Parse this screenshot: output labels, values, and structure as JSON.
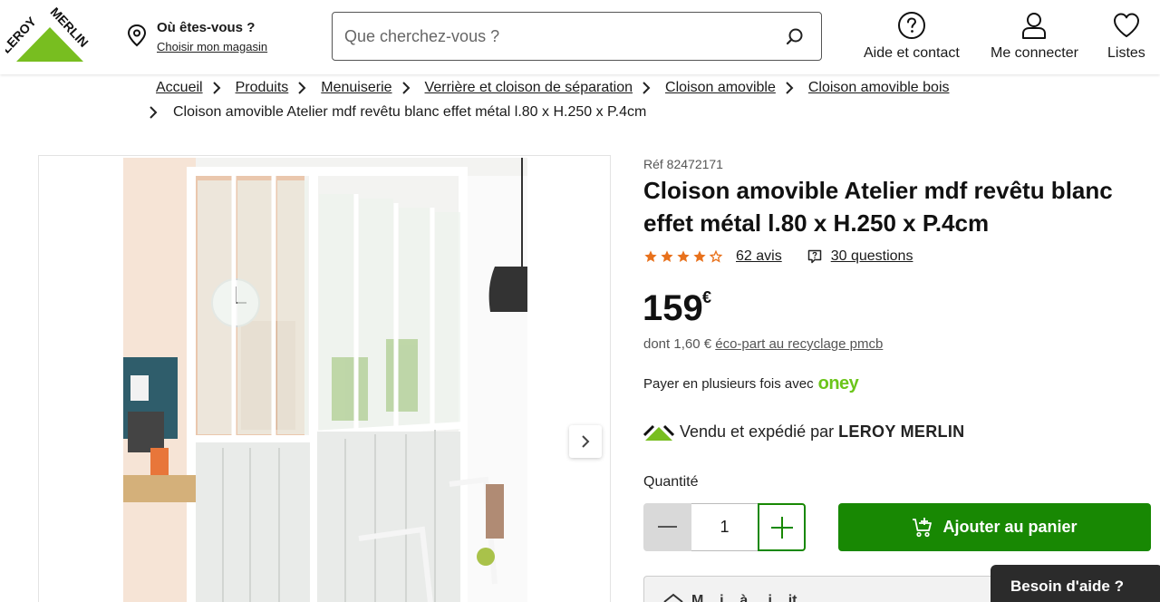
{
  "brand": {
    "logo_text": "LEROY MERLIN",
    "primary_color": "#78be20",
    "accent_green": "#188803"
  },
  "header": {
    "store_title": "Où êtes-vous ?",
    "store_link": "Choisir mon magasin",
    "search_placeholder": "Que cherchez-vous ?",
    "help": "Aide et contact",
    "login": "Me connecter",
    "lists": "Listes"
  },
  "breadcrumb": {
    "items": [
      "Accueil",
      "Produits",
      "Menuiserie",
      "Verrière et cloison de séparation",
      "Cloison amovible",
      "Cloison amovible bois"
    ],
    "current": "Cloison amovible Atelier mdf revêtu blanc effet métal l.80 x H.250 x P.4cm"
  },
  "product": {
    "ref": "Réf 82472171",
    "title": "Cloison amovible Atelier mdf revêtu blanc effet métal l.80 x H.250 x P.4cm",
    "rating": 4.5,
    "rating_max": 5,
    "star_color": "#e8711c",
    "reviews": "62 avis",
    "questions": "30 questions",
    "price": "159",
    "currency": "€",
    "eco_prefix": "dont 1,60 €",
    "eco_link": "éco-part au recyclage pmcb",
    "payment_text": "Payer en plusieurs fois avec",
    "payment_brand": "oney",
    "seller_prefix": "Vendu et expédié par",
    "seller_name": "LEROY MERLIN",
    "quantity_label": "Quantité",
    "quantity": "1",
    "add_to_cart": "Ajouter au panier",
    "more_text": "M... i... à ... i... it..."
  },
  "help_widget": {
    "label": "Besoin d'aide ?"
  }
}
